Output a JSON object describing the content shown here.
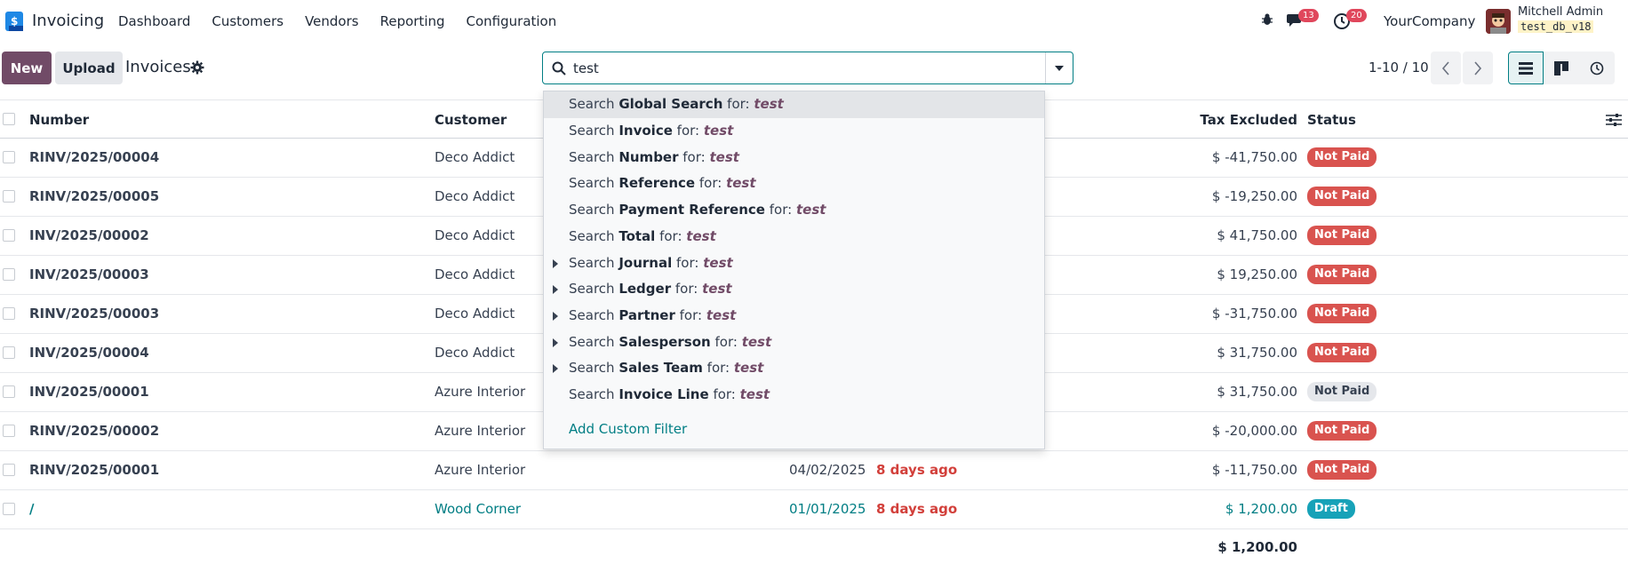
{
  "navbar": {
    "app_name": "Invoicing",
    "menu": [
      "Dashboard",
      "Customers",
      "Vendors",
      "Reporting",
      "Configuration"
    ],
    "chat_badge": "13",
    "activity_badge": "20",
    "company": "YourCompany",
    "user_name": "Mitchell Admin",
    "db_name": "test_db_v18"
  },
  "control_panel": {
    "new_label": "New",
    "upload_label": "Upload",
    "breadcrumb": "Invoices",
    "search_value": "test",
    "pager": "1-10 / 10"
  },
  "table": {
    "headers": {
      "number": "Number",
      "customer": "Customer",
      "tax_excluded": "Tax Excluded",
      "status": "Status"
    },
    "rows": [
      {
        "number": "RINV/2025/00004",
        "customer": "Deco Addict",
        "date": "",
        "due": "",
        "amount": "$ -41,750.00",
        "status": "Not Paid"
      },
      {
        "number": "RINV/2025/00005",
        "customer": "Deco Addict",
        "date": "",
        "due": "",
        "amount": "$ -19,250.00",
        "status": "Not Paid"
      },
      {
        "number": "INV/2025/00002",
        "customer": "Deco Addict",
        "date": "",
        "due": "",
        "amount": "$ 41,750.00",
        "status": "Not Paid"
      },
      {
        "number": "INV/2025/00003",
        "customer": "Deco Addict",
        "date": "",
        "due": "",
        "amount": "$ 19,250.00",
        "status": "Not Paid"
      },
      {
        "number": "RINV/2025/00003",
        "customer": "Deco Addict",
        "date": "",
        "due": "",
        "amount": "$ -31,750.00",
        "status": "Not Paid"
      },
      {
        "number": "INV/2025/00004",
        "customer": "Deco Addict",
        "date": "",
        "due": "",
        "amount": "$ 31,750.00",
        "status": "Not Paid"
      },
      {
        "number": "INV/2025/00001",
        "customer": "Azure Interior",
        "date": "",
        "due": "",
        "amount": "$ 31,750.00",
        "status": "Not Paid"
      },
      {
        "number": "RINV/2025/00002",
        "customer": "Azure Interior",
        "date": "",
        "due": "",
        "amount": "$ -20,000.00",
        "status": "Not Paid"
      },
      {
        "number": "RINV/2025/00001",
        "customer": "Azure Interior",
        "date": "04/02/2025",
        "due": "8 days ago",
        "amount": "$ -11,750.00",
        "status": "Not Paid"
      },
      {
        "number": "/",
        "customer": "Wood Corner",
        "date": "01/01/2025",
        "due": "8 days ago",
        "amount": "$ 1,200.00",
        "status": "Draft"
      }
    ],
    "total": "$ 1,200.00"
  },
  "dropdown": {
    "search_prefix": "Search",
    "for_label": "for:",
    "term": "test",
    "items": [
      {
        "field": "Global Search",
        "expandable": false
      },
      {
        "field": "Invoice",
        "expandable": false
      },
      {
        "field": "Number",
        "expandable": false
      },
      {
        "field": "Reference",
        "expandable": false
      },
      {
        "field": "Payment Reference",
        "expandable": false
      },
      {
        "field": "Total",
        "expandable": false
      },
      {
        "field": "Journal",
        "expandable": true
      },
      {
        "field": "Ledger",
        "expandable": true
      },
      {
        "field": "Partner",
        "expandable": true
      },
      {
        "field": "Salesperson",
        "expandable": true
      },
      {
        "field": "Sales Team",
        "expandable": true
      },
      {
        "field": "Invoice Line",
        "expandable": false
      }
    ],
    "add_custom_filter": "Add Custom Filter"
  },
  "colors": {
    "brand": "#714b67",
    "accent": "#017e84",
    "danger": "#d9534f",
    "draft": "#17a2b8"
  }
}
